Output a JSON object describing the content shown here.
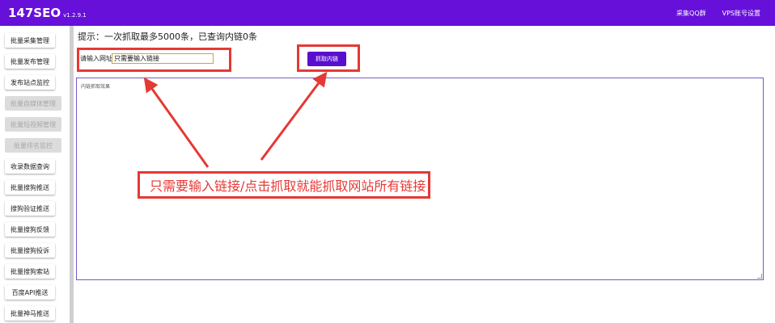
{
  "app": {
    "brand": "147SEO",
    "version": "v1.2.9.1",
    "nav": [
      "采集QQ群",
      "VPS账号设置"
    ]
  },
  "sidebar": {
    "items": [
      {
        "label": "批量采集管理",
        "disabled": false
      },
      {
        "label": "批量发布管理",
        "disabled": false
      },
      {
        "label": "发布站点监控",
        "disabled": false
      },
      {
        "label": "批量自媒体管理",
        "disabled": true
      },
      {
        "label": "批量短视频管理",
        "disabled": true
      },
      {
        "label": "批量排名监控",
        "disabled": true
      },
      {
        "label": "收录数据查询",
        "disabled": false
      },
      {
        "label": "批量搜狗推送",
        "disabled": false
      },
      {
        "label": "搜狗验证推送",
        "disabled": false
      },
      {
        "label": "批量搜狗反馈",
        "disabled": false
      },
      {
        "label": "批量搜狗投诉",
        "disabled": false
      },
      {
        "label": "批量搜狗索站",
        "disabled": false
      },
      {
        "label": "百度API推送",
        "disabled": false
      },
      {
        "label": "批量神马推送",
        "disabled": false
      }
    ]
  },
  "main": {
    "hint": "提示：一次抓取最多5000条，已查询内链0条",
    "url_label": "请输入网址",
    "url_value": "只需要输入链接",
    "fetch_button": "抓取内链",
    "result_label": "内链抓取效果"
  },
  "annotation": {
    "text": "只需要输入链接/点击抓取就能抓取网站所有链接",
    "color": "#e53935"
  },
  "colors": {
    "header": "#6610d9",
    "button": "#5a0fcf",
    "annotation": "#e53935"
  }
}
